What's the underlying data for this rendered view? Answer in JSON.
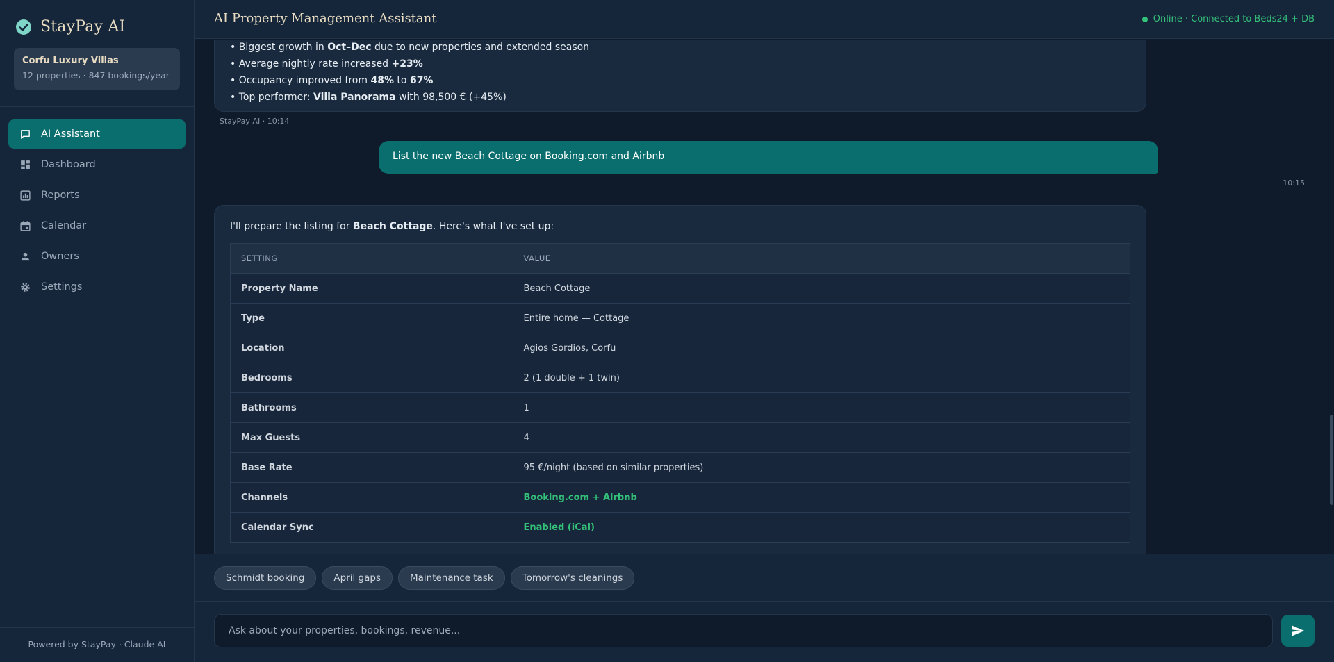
{
  "brand": {
    "name": "StayPay AI",
    "logo_icon": "check-circle-icon",
    "accent": "#0b6e6e"
  },
  "org": {
    "name": "Corfu Luxury Villas",
    "meta": "12 properties · 847 bookings/year"
  },
  "nav": [
    {
      "label": "AI Assistant",
      "icon": "chat-icon",
      "active": true
    },
    {
      "label": "Dashboard",
      "icon": "dashboard-icon",
      "active": false
    },
    {
      "label": "Reports",
      "icon": "reports-icon",
      "active": false
    },
    {
      "label": "Calendar",
      "icon": "calendar-icon",
      "active": false
    },
    {
      "label": "Owners",
      "icon": "person-icon",
      "active": false
    },
    {
      "label": "Settings",
      "icon": "gear-icon",
      "active": false
    }
  ],
  "footer": "Powered by StayPay · Claude AI",
  "header": {
    "title": "AI Property Management Assistant",
    "status": "Online · Connected to Beds24 + DB",
    "status_color": "#34c27a"
  },
  "messages": {
    "first_ai": {
      "lines": [
        {
          "pre": "• Biggest growth in ",
          "bold": "Oct–Dec",
          "post": " due to new properties and extended season"
        },
        {
          "pre": "• Average nightly rate increased ",
          "bold": "+23%",
          "post": ""
        },
        {
          "pre": "• Occupancy improved from ",
          "bold": "48%",
          "mid": " to ",
          "bold2": "67%",
          "post": ""
        },
        {
          "pre": "• Top performer: ",
          "bold": "Villa Panorama",
          "post": " with 98,500 € (+45%)"
        }
      ],
      "meta": "StayPay AI · 10:14"
    },
    "user": {
      "text": "List the new Beach Cottage on Booking.com and Airbnb",
      "time": "10:15"
    },
    "second_ai": {
      "intro_pre": "I'll prepare the listing for ",
      "intro_bold": "Beach Cottage",
      "intro_post": ". Here's what I've set up:",
      "table": {
        "headers": [
          "SETTING",
          "VALUE"
        ],
        "rows": [
          {
            "key": "Property Name",
            "value": "Beach Cottage",
            "highlight": false
          },
          {
            "key": "Type",
            "value": "Entire home — Cottage",
            "highlight": false
          },
          {
            "key": "Location",
            "value": "Agios Gordios, Corfu",
            "highlight": false
          },
          {
            "key": "Bedrooms",
            "value": "2 (1 double + 1 twin)",
            "highlight": false
          },
          {
            "key": "Bathrooms",
            "value": "1",
            "highlight": false
          },
          {
            "key": "Max Guests",
            "value": "4",
            "highlight": false
          },
          {
            "key": "Base Rate",
            "value": "95 €/night (based on similar properties)",
            "highlight": false
          },
          {
            "key": "Channels",
            "value": "Booking.com + Airbnb",
            "highlight": true
          },
          {
            "key": "Calendar Sync",
            "value": "Enabled (iCal)",
            "highlight": true
          }
        ]
      }
    }
  },
  "chips": [
    "Schmidt booking",
    "April gaps",
    "Maintenance task",
    "Tomorrow's cleanings"
  ],
  "input": {
    "placeholder": "Ask about your properties, bookings, revenue..."
  },
  "send_icon": "send-icon"
}
